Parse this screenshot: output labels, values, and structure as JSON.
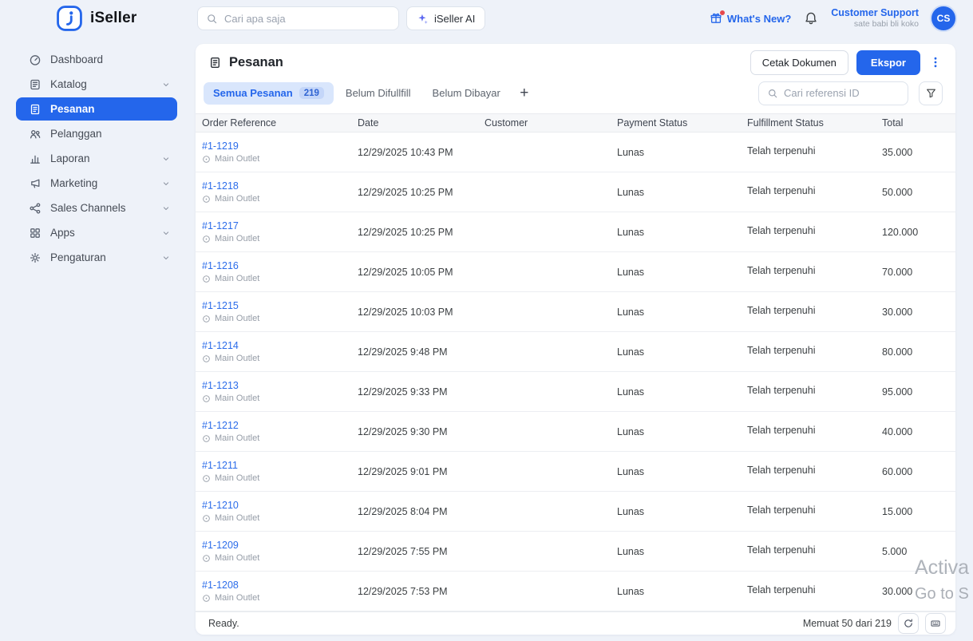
{
  "colors": {
    "accent": "#2466eb",
    "link": "#2b6cea",
    "page_background": "#eef2f9",
    "active_tab_background": "#d9e6fc",
    "table_header_background": "#f6f7f9"
  },
  "header": {
    "brand": "iSeller",
    "search_placeholder": "Cari apa saja",
    "ai_button_label": "iSeller AI",
    "whats_new_label": "What's New?",
    "support_title": "Customer Support",
    "support_subtitle": "sate babi bli koko",
    "avatar_initials": "CS"
  },
  "sidebar": {
    "items": [
      {
        "id": "dashboard",
        "label": "Dashboard",
        "icon": "dashboard-icon",
        "chevron": false,
        "active": false
      },
      {
        "id": "katalog",
        "label": "Katalog",
        "icon": "catalog-icon",
        "chevron": true,
        "active": false
      },
      {
        "id": "pesanan",
        "label": "Pesanan",
        "icon": "orders-icon",
        "chevron": false,
        "active": true
      },
      {
        "id": "pelanggan",
        "label": "Pelanggan",
        "icon": "customers-icon",
        "chevron": false,
        "active": false
      },
      {
        "id": "laporan",
        "label": "Laporan",
        "icon": "reports-icon",
        "chevron": true,
        "active": false
      },
      {
        "id": "marketing",
        "label": "Marketing",
        "icon": "marketing-icon",
        "chevron": true,
        "active": false
      },
      {
        "id": "sales-channels",
        "label": "Sales Channels",
        "icon": "sales-channels-icon",
        "chevron": true,
        "active": false
      },
      {
        "id": "apps",
        "label": "Apps",
        "icon": "apps-icon",
        "chevron": true,
        "active": false
      },
      {
        "id": "pengaturan",
        "label": "Pengaturan",
        "icon": "settings-icon",
        "chevron": true,
        "active": false
      }
    ]
  },
  "page": {
    "title": "Pesanan",
    "print_button_label": "Cetak Dokumen",
    "export_button_label": "Ekspor"
  },
  "tabs": [
    {
      "label": "Semua Pesanan",
      "badge": "219",
      "active": true
    },
    {
      "label": "Belum Difullfill",
      "active": false
    },
    {
      "label": "Belum Dibayar",
      "active": false
    }
  ],
  "toolbar": {
    "add_tab_label": "+",
    "search_placeholder": "Cari referensi ID"
  },
  "table": {
    "columns": [
      "Order Reference",
      "Date",
      "Customer",
      "Payment Status",
      "Fulfillment Status",
      "Total"
    ],
    "rows": [
      {
        "ref": "#1-1219",
        "outlet": "Main Outlet",
        "date": "12/29/2025 10:43 PM",
        "customer": "",
        "payment": "Lunas",
        "fulfillment": "Telah terpenuhi",
        "total": "35.000"
      },
      {
        "ref": "#1-1218",
        "outlet": "Main Outlet",
        "date": "12/29/2025 10:25 PM",
        "customer": "",
        "payment": "Lunas",
        "fulfillment": "Telah terpenuhi",
        "total": "50.000"
      },
      {
        "ref": "#1-1217",
        "outlet": "Main Outlet",
        "date": "12/29/2025 10:25 PM",
        "customer": "",
        "payment": "Lunas",
        "fulfillment": "Telah terpenuhi",
        "total": "120.000"
      },
      {
        "ref": "#1-1216",
        "outlet": "Main Outlet",
        "date": "12/29/2025 10:05 PM",
        "customer": "",
        "payment": "Lunas",
        "fulfillment": "Telah terpenuhi",
        "total": "70.000"
      },
      {
        "ref": "#1-1215",
        "outlet": "Main Outlet",
        "date": "12/29/2025 10:03 PM",
        "customer": "",
        "payment": "Lunas",
        "fulfillment": "Telah terpenuhi",
        "total": "30.000"
      },
      {
        "ref": "#1-1214",
        "outlet": "Main Outlet",
        "date": "12/29/2025 9:48 PM",
        "customer": "",
        "payment": "Lunas",
        "fulfillment": "Telah terpenuhi",
        "total": "80.000"
      },
      {
        "ref": "#1-1213",
        "outlet": "Main Outlet",
        "date": "12/29/2025 9:33 PM",
        "customer": "",
        "payment": "Lunas",
        "fulfillment": "Telah terpenuhi",
        "total": "95.000"
      },
      {
        "ref": "#1-1212",
        "outlet": "Main Outlet",
        "date": "12/29/2025 9:30 PM",
        "customer": "",
        "payment": "Lunas",
        "fulfillment": "Telah terpenuhi",
        "total": "40.000"
      },
      {
        "ref": "#1-1211",
        "outlet": "Main Outlet",
        "date": "12/29/2025 9:01 PM",
        "customer": "",
        "payment": "Lunas",
        "fulfillment": "Telah terpenuhi",
        "total": "60.000"
      },
      {
        "ref": "#1-1210",
        "outlet": "Main Outlet",
        "date": "12/29/2025 8:04 PM",
        "customer": "",
        "payment": "Lunas",
        "fulfillment": "Telah terpenuhi",
        "total": "15.000"
      },
      {
        "ref": "#1-1209",
        "outlet": "Main Outlet",
        "date": "12/29/2025 7:55 PM",
        "customer": "",
        "payment": "Lunas",
        "fulfillment": "Telah terpenuhi",
        "total": "5.000"
      },
      {
        "ref": "#1-1208",
        "outlet": "Main Outlet",
        "date": "12/29/2025 7:53 PM",
        "customer": "",
        "payment": "Lunas",
        "fulfillment": "Telah terpenuhi",
        "total": "30.000"
      }
    ]
  },
  "statusbar": {
    "status": "Ready.",
    "load_info": "Memuat 50 dari 219"
  },
  "watermark": {
    "line1": "Activa",
    "line2": "Go to S"
  }
}
